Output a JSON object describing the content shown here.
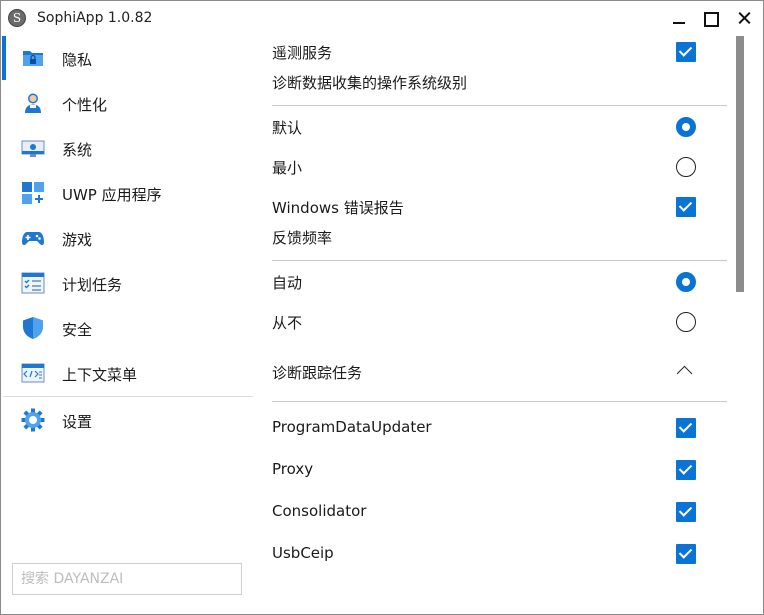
{
  "window": {
    "title": "SophiApp 1.0.82"
  },
  "sidebar": {
    "items": [
      {
        "label": "隐私",
        "icon": "privacy-folder-icon",
        "active": true
      },
      {
        "label": "个性化",
        "icon": "personalization-user-icon"
      },
      {
        "label": "系统",
        "icon": "system-monitor-icon"
      },
      {
        "label": "UWP 应用程序",
        "icon": "uwp-apps-grid-icon"
      },
      {
        "label": "游戏",
        "icon": "gamepad-icon"
      },
      {
        "label": "计划任务",
        "icon": "scheduled-tasks-checklist-icon"
      },
      {
        "label": "安全",
        "icon": "security-shield-icon"
      },
      {
        "label": "上下文菜单",
        "icon": "context-menu-code-icon"
      },
      {
        "label": "设置",
        "icon": "settings-gear-icon"
      }
    ],
    "search_placeholder": "搜索 DAYANZAI"
  },
  "content": {
    "telemetry": {
      "label": "遥测服务",
      "checked": true
    },
    "diag_level": {
      "title": "诊断数据收集的操作系统级别",
      "options": [
        {
          "label": "默认",
          "selected": true
        },
        {
          "label": "最小",
          "selected": false
        }
      ]
    },
    "error_reporting": {
      "label": "Windows 错误报告",
      "checked": true
    },
    "feedback": {
      "title": "反馈频率",
      "options": [
        {
          "label": "自动",
          "selected": true
        },
        {
          "label": "从不",
          "selected": false
        }
      ]
    },
    "tracking": {
      "label": "诊断跟踪任务",
      "expanded": true,
      "tasks": [
        {
          "label": "ProgramDataUpdater",
          "checked": true
        },
        {
          "label": "Proxy",
          "checked": true
        },
        {
          "label": "Consolidator",
          "checked": true
        },
        {
          "label": "UsbCeip",
          "checked": true
        }
      ]
    }
  },
  "colors": {
    "accent": "#0a74d6",
    "scrollbar": "#8c8c8c"
  }
}
